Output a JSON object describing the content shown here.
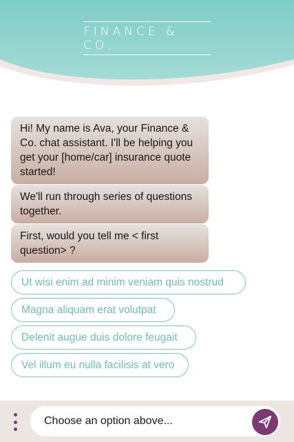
{
  "header": {
    "brand": "FINANCE & CO."
  },
  "messages": [
    "Hi! My name is Ava, your Finance & Co. chat assistant.  I'll be helping you get your [home/car] insurance quote started!",
    "We'll run through series of questions together.",
    "First, would you tell me < first question> ?"
  ],
  "options": [
    "Ut wisi enim ad minim veniam quis nostrud",
    "Magna aliquam erat volutpat",
    "Delenit augue duis dolore feugait",
    "Vel illum eu nulla facilisis at vero"
  ],
  "composer": {
    "placeholder": "Choose an option above..."
  },
  "icons": {
    "menu": "vertical-dots-icon",
    "send": "paper-plane-icon"
  },
  "colors": {
    "teal": "#7cc9c3",
    "plum": "#7b3a72",
    "bubble": "#c8aea2"
  }
}
